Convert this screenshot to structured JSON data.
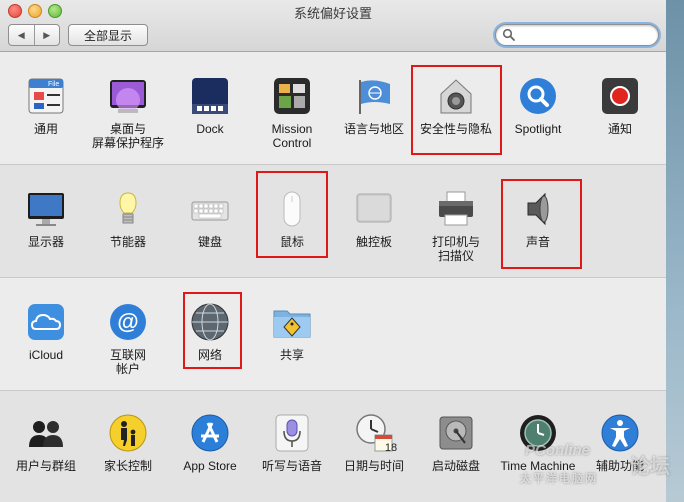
{
  "window": {
    "title": "系统偏好设置"
  },
  "toolbar": {
    "back_glyph": "◀",
    "forward_glyph": "▶",
    "show_all_label": "全部显示",
    "search_placeholder": ""
  },
  "rows": [
    {
      "items": [
        {
          "id": "general",
          "label": "通用",
          "icon": "general-icon"
        },
        {
          "id": "desktop",
          "label": "桌面与\n屏幕保护程序",
          "icon": "desktop-screensaver-icon"
        },
        {
          "id": "dock",
          "label": "Dock",
          "icon": "dock-icon"
        },
        {
          "id": "mission",
          "label": "Mission\nControl",
          "icon": "mission-control-icon"
        },
        {
          "id": "language",
          "label": "语言与地区",
          "icon": "language-region-icon"
        },
        {
          "id": "security",
          "label": "安全性与隐私",
          "icon": "security-privacy-icon",
          "highlighted": true
        },
        {
          "id": "spotlight",
          "label": "Spotlight",
          "icon": "spotlight-icon"
        },
        {
          "id": "notifications",
          "label": "通知",
          "icon": "notifications-icon"
        }
      ]
    },
    {
      "items": [
        {
          "id": "displays",
          "label": "显示器",
          "icon": "displays-icon"
        },
        {
          "id": "energy",
          "label": "节能器",
          "icon": "energy-saver-icon"
        },
        {
          "id": "keyboard",
          "label": "键盘",
          "icon": "keyboard-icon"
        },
        {
          "id": "mouse",
          "label": "鼠标",
          "icon": "mouse-icon",
          "highlighted": true
        },
        {
          "id": "trackpad",
          "label": "触控板",
          "icon": "trackpad-icon"
        },
        {
          "id": "printers",
          "label": "打印机与\n扫描仪",
          "icon": "printer-icon"
        },
        {
          "id": "sound",
          "label": "声音",
          "icon": "sound-icon",
          "highlighted": true
        }
      ]
    },
    {
      "items": [
        {
          "id": "icloud",
          "label": "iCloud",
          "icon": "icloud-icon"
        },
        {
          "id": "internet",
          "label": "互联网\n帐户",
          "icon": "internet-accounts-icon"
        },
        {
          "id": "network",
          "label": "网络",
          "icon": "network-icon",
          "highlighted": true
        },
        {
          "id": "sharing",
          "label": "共享",
          "icon": "sharing-icon"
        }
      ]
    },
    {
      "items": [
        {
          "id": "users",
          "label": "用户与群组",
          "icon": "users-groups-icon"
        },
        {
          "id": "parental",
          "label": "家长控制",
          "icon": "parental-controls-icon"
        },
        {
          "id": "appstore",
          "label": "App Store",
          "icon": "app-store-icon"
        },
        {
          "id": "dictation",
          "label": "听写与语音",
          "icon": "dictation-speech-icon"
        },
        {
          "id": "datetime",
          "label": "日期与时间",
          "icon": "date-time-icon"
        },
        {
          "id": "startup",
          "label": "启动磁盘",
          "icon": "startup-disk-icon"
        },
        {
          "id": "timemachine",
          "label": "Time Machine",
          "icon": "time-machine-icon"
        },
        {
          "id": "accessibility",
          "label": "辅助功能",
          "icon": "accessibility-icon"
        }
      ]
    }
  ],
  "calendar_day": "18",
  "watermark": {
    "brand": "PConline",
    "side": "论坛",
    "sub": "太平洋电脑网"
  },
  "colors": {
    "highlight": "#e11818",
    "spotlight_blue": "#2f7fd8"
  }
}
